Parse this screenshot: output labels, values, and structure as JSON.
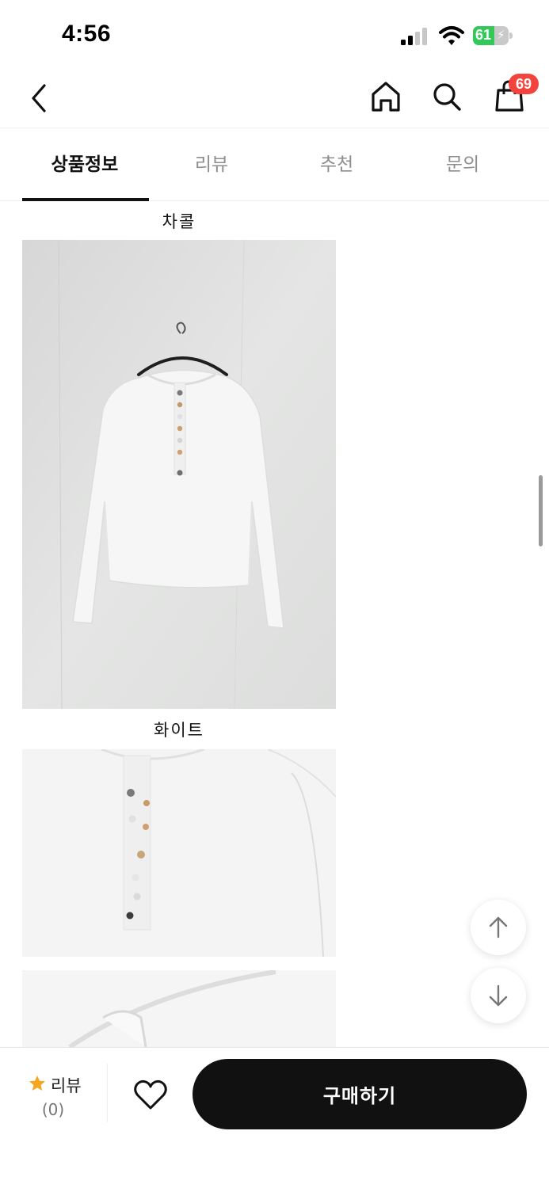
{
  "status_bar": {
    "time": "4:56",
    "battery_level": "61",
    "battery_fraction": 0.61,
    "icons": [
      "signal-icon",
      "wifi-icon",
      "battery-icon"
    ]
  },
  "nav": {
    "back_icon": "chevron-left-icon",
    "home_icon": "home-icon",
    "search_icon": "search-icon",
    "cart_icon": "shopping-bag-icon",
    "cart_count": "69"
  },
  "tabs": [
    {
      "label": "상품정보",
      "active": true
    },
    {
      "label": "리뷰",
      "active": false
    },
    {
      "label": "추천",
      "active": false
    },
    {
      "label": "문의",
      "active": false
    }
  ],
  "content": {
    "captions": [
      "차콜",
      "화이트"
    ],
    "images": [
      "white-henley-tshirt-on-hanger",
      "white-henley-buttons-closeup",
      "white-henley-collar-closeup"
    ]
  },
  "floating": {
    "scroll_up_icon": "arrow-up-icon",
    "scroll_down_icon": "arrow-down-icon"
  },
  "bottom_bar": {
    "star_icon": "star-icon",
    "review_label": "리뷰",
    "review_count": "(0)",
    "wish_icon": "heart-icon",
    "buy_label": "구매하기"
  },
  "colors": {
    "accent": "#111111",
    "badge": "#f2433c",
    "star": "#f5a623",
    "battery": "#34c759"
  }
}
